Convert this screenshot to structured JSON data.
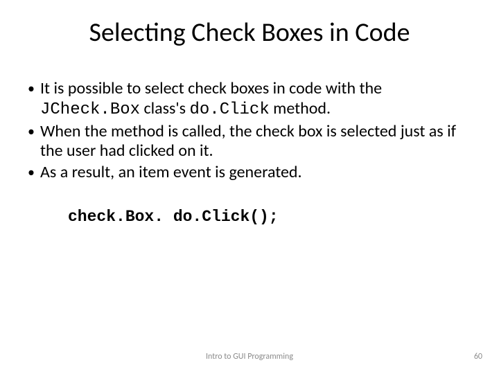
{
  "title": "Selecting Check Boxes in Code",
  "bullets": [
    {
      "pre": "It is possible to select check boxes in code with the ",
      "code1": "JCheck.Box",
      "mid": " class's ",
      "code2": "do.Click",
      "post": " method."
    },
    {
      "pre": "When the method is called, the check box is selected just as if the user had clicked on it.",
      "code1": "",
      "mid": "",
      "code2": "",
      "post": ""
    },
    {
      "pre": "As a result, an item event is generated.",
      "code1": "",
      "mid": "",
      "code2": "",
      "post": ""
    }
  ],
  "code_line": "check.Box. do.Click();",
  "footer": {
    "center": "Intro to GUI Programming",
    "page": "60"
  }
}
